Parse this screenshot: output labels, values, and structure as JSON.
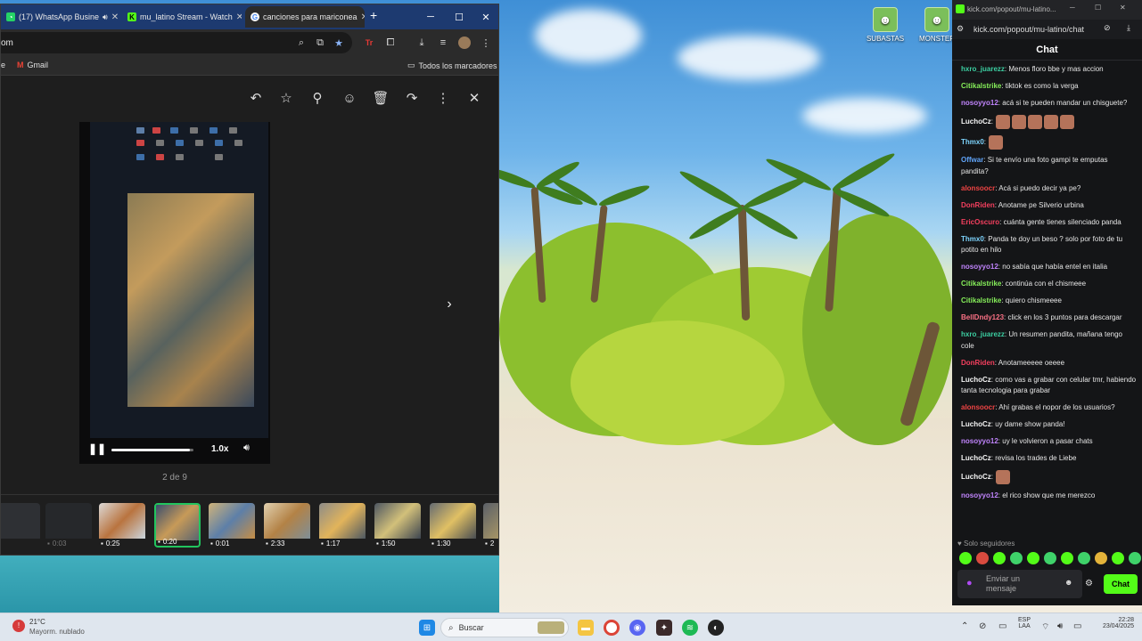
{
  "browser": {
    "tabs": [
      {
        "label": "(17) WhatsApp Busine",
        "icon": "whatsapp-icon"
      },
      {
        "label": "mu_latino Stream - Watch",
        "icon": "kick-icon"
      },
      {
        "label": "canciones para mariconea",
        "icon": "google-icon"
      }
    ],
    "url": "om",
    "bookmarks": [
      {
        "label": "e"
      },
      {
        "label": "Gmail"
      },
      {
        "label": "Todos los marcadores"
      }
    ]
  },
  "viewer": {
    "counter": "2 de 9",
    "speed": "1.0x",
    "progress": 0.96,
    "thumbs": [
      {
        "duration": ""
      },
      {
        "duration": "0:03"
      },
      {
        "duration": "0:25"
      },
      {
        "duration": "0:20"
      },
      {
        "duration": "0:01"
      },
      {
        "duration": "2:33"
      },
      {
        "duration": "1:17"
      },
      {
        "duration": "1:50"
      },
      {
        "duration": "1:30"
      },
      {
        "duration": "2"
      }
    ]
  },
  "desktop": {
    "icons": [
      {
        "label": "SUBASTAS"
      },
      {
        "label": "MONSTER"
      }
    ]
  },
  "kick": {
    "title": "kick.com/popout/mu-latino...",
    "url": "kick.com/popout/mu-latino/chat",
    "header": "Chat",
    "messages": [
      {
        "user": "hxro_juarezz",
        "color": "#3ccfa2",
        "text": ": Menos floro bbe y mas accion"
      },
      {
        "user": "Citikalstrike",
        "color": "#86ef5a",
        "text": ": tiktok es como la verga"
      },
      {
        "user": "nosoyyo12",
        "color": "#c084fc",
        "text": ": acá si te pueden mandar un chisguete?"
      },
      {
        "user": "LuchoCz",
        "color": "#f5f5f5",
        "text": ":",
        "emotes": 5
      },
      {
        "user": "Thmx0",
        "color": "#7dd3fc",
        "text": ":",
        "emotes": 1
      },
      {
        "user": "Offwar",
        "color": "#60a5fa",
        "text": ": Si te envío una foto gampi te emputas pandita?"
      },
      {
        "user": "alonsoocr",
        "color": "#ef4444",
        "text": ": Acá si puedo decir ya pe?"
      },
      {
        "user": "DonRiden",
        "color": "#f43f5e",
        "text": ": Anotame pe Silverio urbina"
      },
      {
        "user": "EricOscuro",
        "color": "#f43f5e",
        "text": ": cuánta gente tienes silenciado panda"
      },
      {
        "user": "Thmx0",
        "color": "#7dd3fc",
        "text": ": Panda te doy un beso ? solo por foto de tu potito en hilo"
      },
      {
        "user": "nosoyyo12",
        "color": "#c084fc",
        "text": ": no sabía que había entel en italia"
      },
      {
        "user": "Citikalstrike",
        "color": "#86ef5a",
        "text": ": continúa con el chismeee"
      },
      {
        "user": "Citikalstrike",
        "color": "#86ef5a",
        "text": ": quiero chismeeee"
      },
      {
        "user": "BellDndy123",
        "color": "#fb7185",
        "text": ": click en los 3 puntos para descargar"
      },
      {
        "user": "hxro_juarezz",
        "color": "#3ccfa2",
        "text": ": Un resumen pandita, mañana tengo cole"
      },
      {
        "user": "DonRiden",
        "color": "#f43f5e",
        "text": ": Anotameeeee oeeee"
      },
      {
        "user": "LuchoCz",
        "color": "#f5f5f5",
        "text": ": como vas a grabar con celular tmr, habiendo tanta tecnologia para grabar"
      },
      {
        "user": "alonsoocr",
        "color": "#ef4444",
        "text": ": Ahí grabas el nopor de los usuarios?"
      },
      {
        "user": "LuchoCz",
        "color": "#f5f5f5",
        "text": ": uy dame show panda!"
      },
      {
        "user": "nosoyyo12",
        "color": "#c084fc",
        "text": ": uy le volvieron a pasar chats"
      },
      {
        "user": "LuchoCz",
        "color": "#f5f5f5",
        "text": ": revisa los trades de Liebe"
      },
      {
        "user": "LuchoCz",
        "color": "#f5f5f5",
        "text": ":",
        "emotes": 1
      },
      {
        "user": "nosoyyo12",
        "color": "#c084fc",
        "text": ": el rico show que me merezco"
      }
    ],
    "follow_label": "Solo seguidores",
    "input_placeholder": "Enviar un mensaje",
    "send_label": "Chat",
    "accent": "#53fc18"
  },
  "taskbar": {
    "weather_temp": "21°C",
    "weather_desc": "Mayorm. nublado",
    "search_placeholder": "Buscar",
    "lang_top": "ESP",
    "lang_bottom": "LAA",
    "time": "22:28",
    "date": "23/04/2025"
  }
}
